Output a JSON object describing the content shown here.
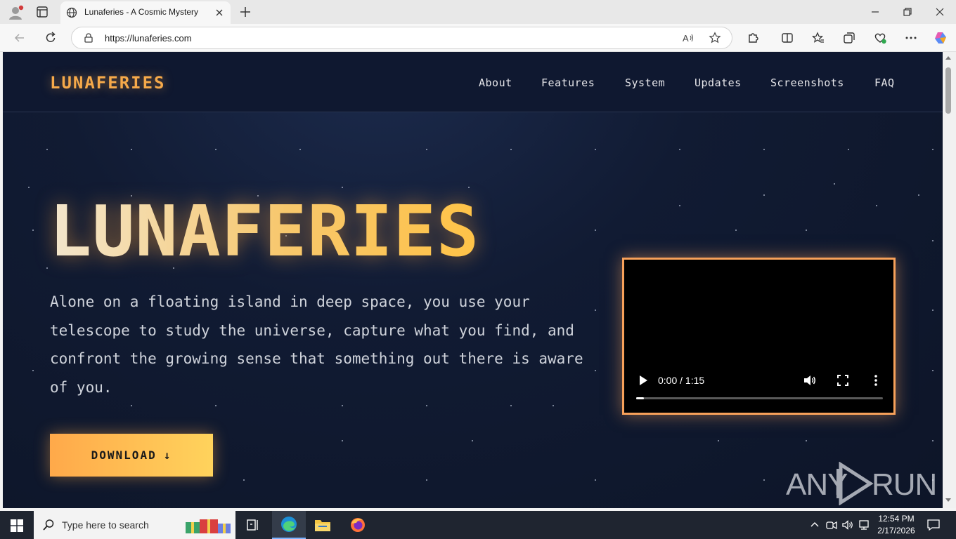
{
  "browser": {
    "tab_title": "Lunaferies - A Cosmic Mystery",
    "url": "https://lunaferies.com"
  },
  "site": {
    "logo": "LUNAFERIES",
    "nav": [
      "About",
      "Features",
      "System",
      "Updates",
      "Screenshots",
      "FAQ"
    ],
    "hero_title": "LUNAFERIES",
    "hero_description": "Alone on a floating island in deep space, you use your telescope to study the universe, capture what you find, and confront the growing sense that something out there is aware of you.",
    "download_label": "DOWNLOAD",
    "download_arrow": "↓",
    "video": {
      "time": "0:00 / 1:15",
      "progress": 0.03
    },
    "watermark_left": "ANY",
    "watermark_right": "RUN"
  },
  "taskbar": {
    "search_placeholder": "Type here to search",
    "time": "12:54 PM",
    "date": "2/17/2026"
  },
  "colors": {
    "accent": "#f5a94a",
    "page_bg": "#111b33",
    "video_border": "#f7a15a"
  }
}
